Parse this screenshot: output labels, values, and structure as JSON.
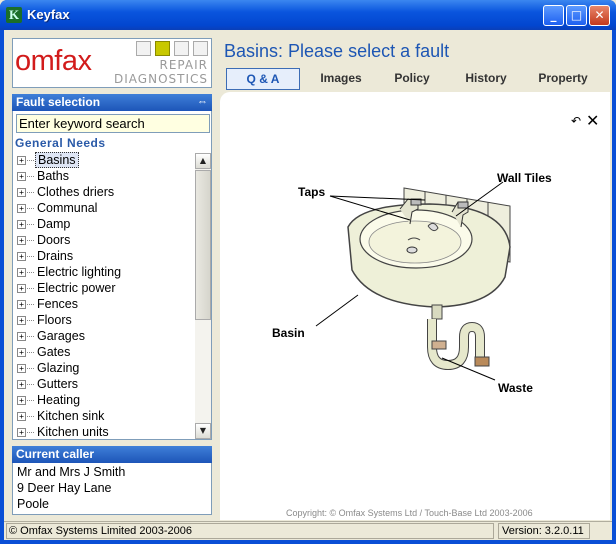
{
  "window": {
    "title": "Keyfax",
    "app_icon_glyph": "K"
  },
  "logo": {
    "brand": "omfax",
    "tag1": "REPAIR",
    "tag2": "DIAGNOSTICS"
  },
  "fault_selection": {
    "header": "Fault selection",
    "search_placeholder": "Enter keyword search",
    "group": "General Needs",
    "items": [
      "Basins",
      "Baths",
      "Clothes driers",
      "Communal",
      "Damp",
      "Doors",
      "Drains",
      "Electric lighting",
      "Electric power",
      "Fences",
      "Floors",
      "Garages",
      "Gates",
      "Glazing",
      "Gutters",
      "Heating",
      "Kitchen sink",
      "Kitchen units"
    ],
    "selected": "Basins"
  },
  "current_caller": {
    "header": "Current caller",
    "lines": [
      "Mr and Mrs J Smith",
      "9 Deer Hay Lane",
      "Poole"
    ]
  },
  "main": {
    "title": "Basins: Please select a fault",
    "tabs": [
      "Q & A",
      "Images",
      "Policy",
      "History",
      "Property"
    ],
    "active_tab": "Q & A",
    "diagram_labels": {
      "taps": "Taps",
      "wall_tiles": "Wall Tiles",
      "basin": "Basin",
      "waste": "Waste"
    },
    "copyright": "Copyright: © Omfax Systems Ltd / Touch-Base Ltd 2003-2006"
  },
  "status": {
    "left": "© Omfax Systems Limited 2003-2006",
    "version": "Version: 3.2.0.11"
  },
  "colors": {
    "title_blue": "#1d56b4",
    "brand_red": "#d21b1b",
    "panel_header": "#1d55b8"
  }
}
